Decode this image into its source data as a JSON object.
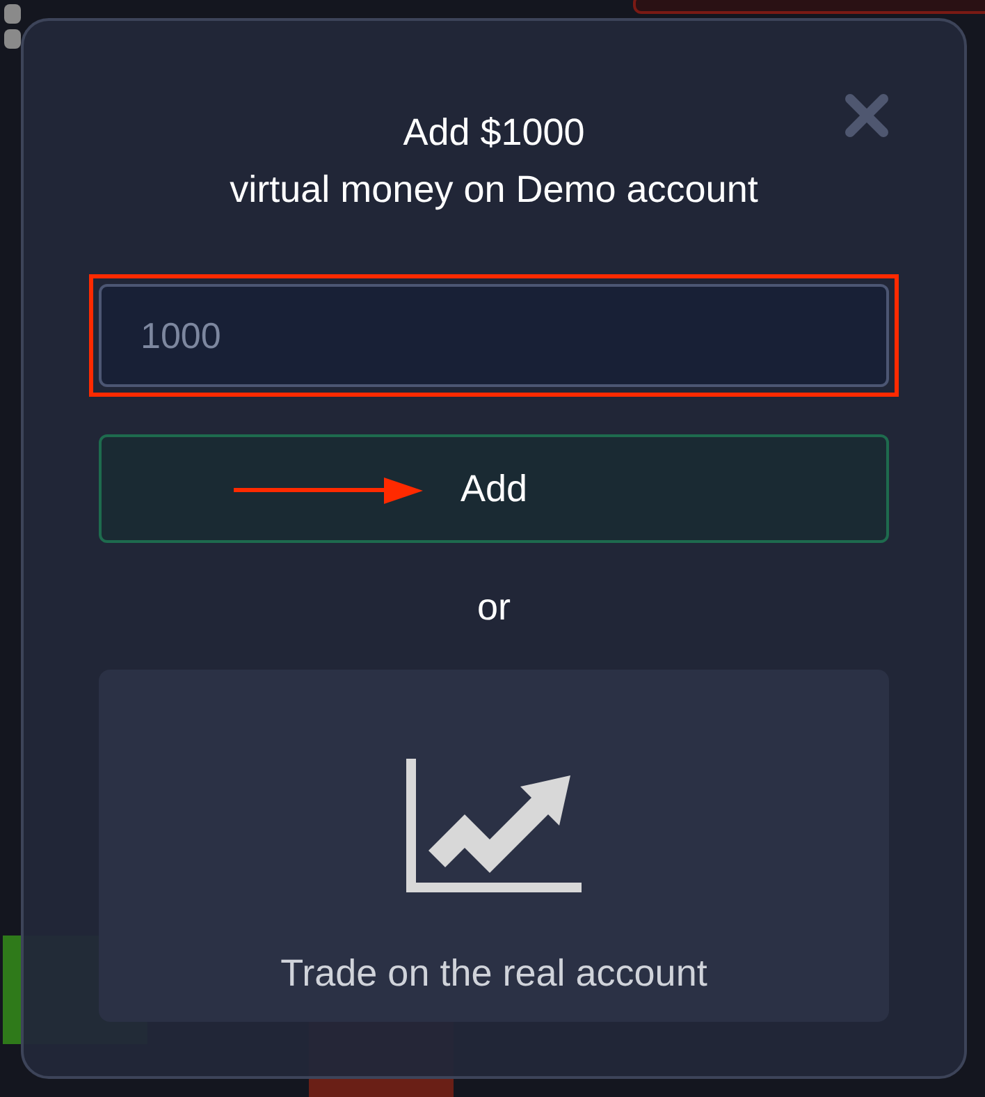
{
  "dialog": {
    "title_line_1": "Add $1000",
    "title_line_2": "virtual money on Demo account"
  },
  "amount_field": {
    "placeholder": "1000",
    "highlighted": true
  },
  "add_button": {
    "label": "Add",
    "arrow": true
  },
  "separator": "or",
  "real_account_card": {
    "label": "Trade on the real account"
  }
}
